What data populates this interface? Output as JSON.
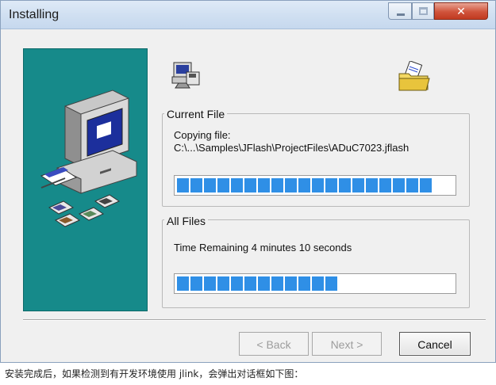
{
  "window": {
    "title": "Installing"
  },
  "current_file": {
    "label": "Current File",
    "status": "Copying file:",
    "path": "C:\\...\\Samples\\JFlash\\ProjectFiles\\ADuC7023.jflash",
    "progress_fraction": 0.96
  },
  "all_files": {
    "label": "All Files",
    "status": "Time Remaining 4 minutes 10 seconds",
    "progress_fraction": 0.58
  },
  "buttons": {
    "back": "< Back",
    "next": "Next >",
    "cancel": "Cancel"
  },
  "caption": "安装完成后，如果检测到有开发环境使用 jlink，会弹出对话框如下图：",
  "icons": {
    "installer": "installer-icon",
    "folder": "folder-icon",
    "computer": "computer-icon",
    "floppy_disks": "floppy-disk-icon"
  },
  "colors": {
    "banner": "#168a8a",
    "progress_fill": "#2f8fe6"
  }
}
